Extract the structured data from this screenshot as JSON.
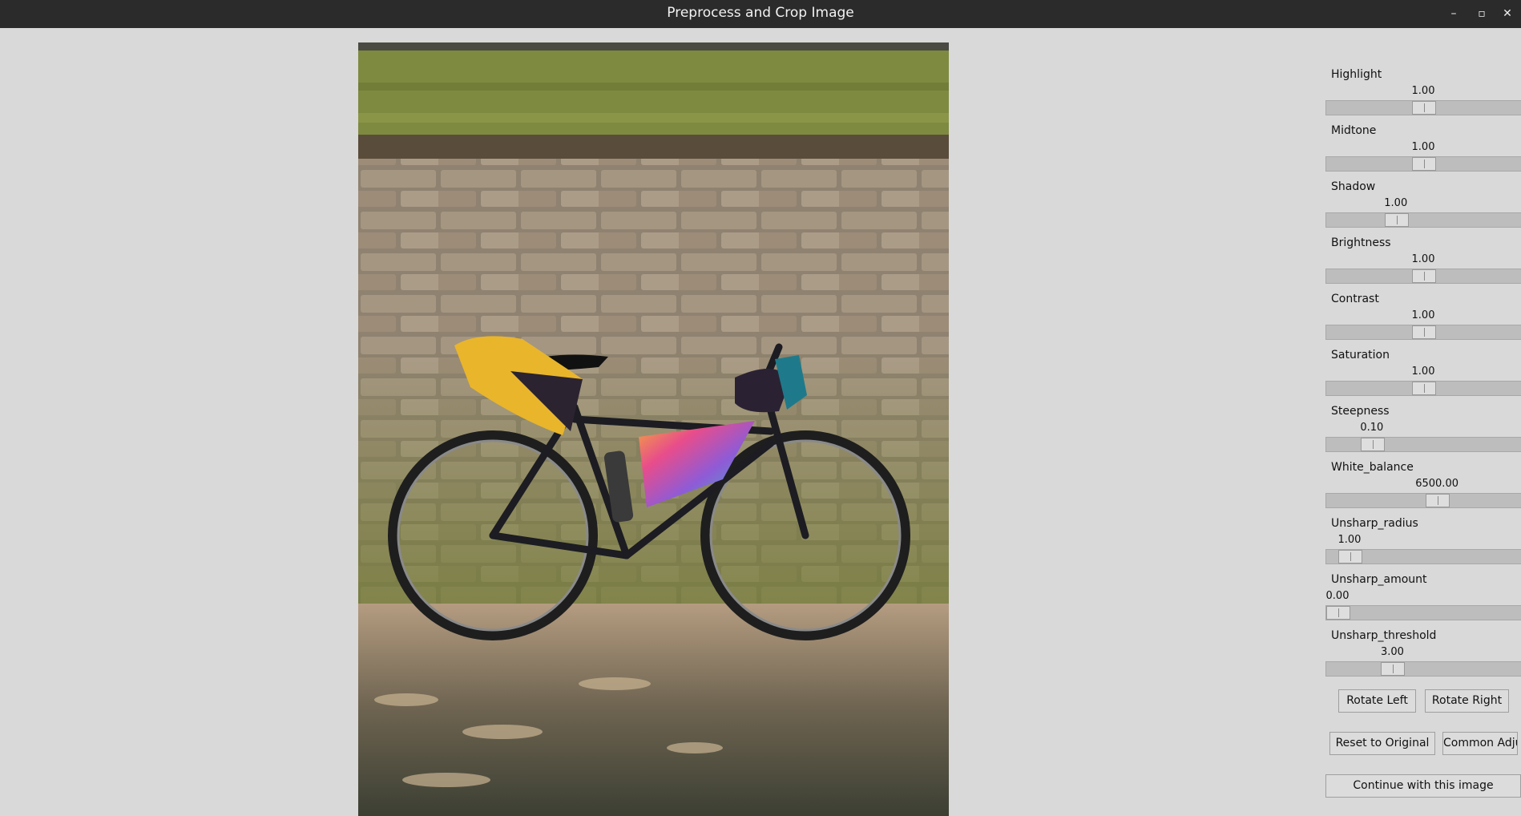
{
  "window": {
    "title": "Preprocess and Crop Image",
    "controls": {
      "minimize": "–",
      "maximize": "▫",
      "close": "✕"
    }
  },
  "sliders": [
    {
      "label": "Highlight",
      "value": "1.00",
      "fraction": 0.5
    },
    {
      "label": "Midtone",
      "value": "1.00",
      "fraction": 0.5
    },
    {
      "label": "Shadow",
      "value": "1.00",
      "fraction": 0.34
    },
    {
      "label": "Brightness",
      "value": "1.00",
      "fraction": 0.5
    },
    {
      "label": "Contrast",
      "value": "1.00",
      "fraction": 0.5
    },
    {
      "label": "Saturation",
      "value": "1.00",
      "fraction": 0.5
    },
    {
      "label": "Steepness",
      "value": "0.10",
      "fraction": 0.2
    },
    {
      "label": "White_balance",
      "value": "6500.00",
      "fraction": 0.58
    },
    {
      "label": "Unsharp_radius",
      "value": "1.00",
      "fraction": 0.07
    },
    {
      "label": "Unsharp_amount",
      "value": "0.00",
      "fraction": 0.0
    },
    {
      "label": "Unsharp_threshold",
      "value": "3.00",
      "fraction": 0.32
    }
  ],
  "buttons": {
    "rotate_left": "Rotate Left",
    "rotate_right": "Rotate Right",
    "reset": "Reset to Original",
    "common": "Common Adjustments",
    "continue": "Continue with this image"
  },
  "photo": {
    "subject": "bicycle-photo"
  }
}
